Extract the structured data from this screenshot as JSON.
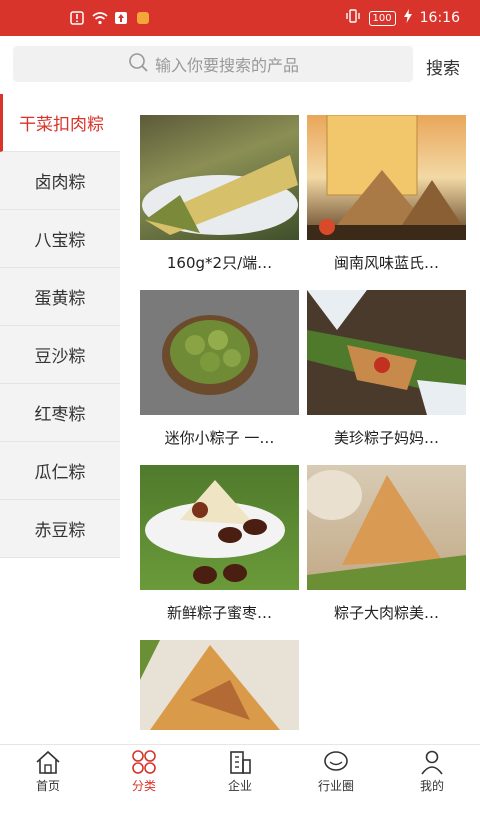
{
  "status": {
    "time": "16:16",
    "battery": "100"
  },
  "search": {
    "placeholder": "输入你要搜索的产品",
    "button": "搜索"
  },
  "sidebar": {
    "items": [
      {
        "label": "干菜扣肉粽",
        "active": true
      },
      {
        "label": "卤肉粽"
      },
      {
        "label": "八宝粽"
      },
      {
        "label": "蛋黄粽"
      },
      {
        "label": "豆沙粽"
      },
      {
        "label": "红枣粽"
      },
      {
        "label": "瓜仁粽"
      },
      {
        "label": "赤豆粽"
      }
    ]
  },
  "products": [
    {
      "title": "160g*2只/端…"
    },
    {
      "title": "闽南风味蓝氏…"
    },
    {
      "title": "迷你小粽子 一…"
    },
    {
      "title": "美珍粽子妈妈…"
    },
    {
      "title": "新鲜粽子蜜枣…"
    },
    {
      "title": "粽子大肉粽美…"
    },
    {
      "title": ""
    }
  ],
  "tabs": [
    {
      "label": "首页"
    },
    {
      "label": "分类",
      "active": true
    },
    {
      "label": "企业"
    },
    {
      "label": "行业圈"
    },
    {
      "label": "我的"
    }
  ],
  "colors": {
    "accent": "#d9342b"
  }
}
